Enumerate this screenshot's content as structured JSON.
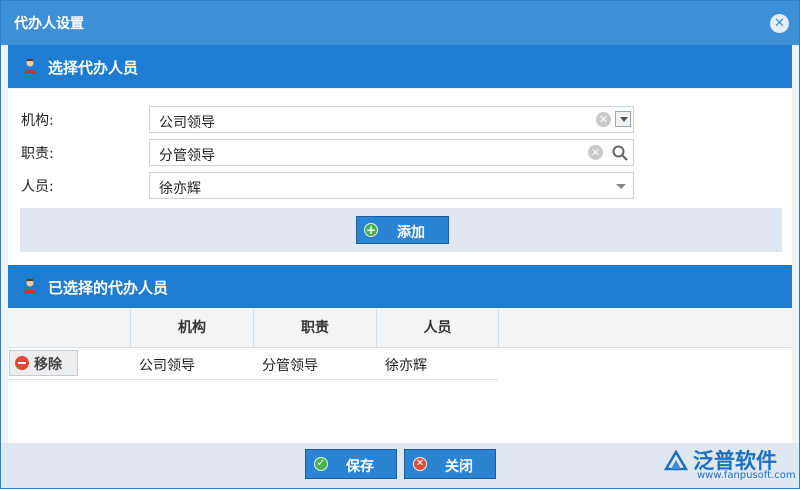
{
  "dialog": {
    "title": "代办人设置",
    "close_icon": "close-icon"
  },
  "section_select": {
    "title": "选择代办人员"
  },
  "form": {
    "org_label": "机构:",
    "org_value": "公司领导",
    "duty_label": "职责:",
    "duty_value": "分管领导",
    "person_label": "人员:",
    "person_value": "徐亦辉"
  },
  "add_button": {
    "label": "添加"
  },
  "section_selected": {
    "title": "已选择的代办人员"
  },
  "grid": {
    "headers": [
      "机构",
      "职责",
      "人员"
    ],
    "rows": [
      {
        "action": "移除",
        "org": "公司领导",
        "duty": "分管领导",
        "person": "徐亦辉"
      }
    ]
  },
  "footer": {
    "save_label": "保存",
    "close_label": "关闭",
    "logo_text": "泛普软件",
    "logo_url": "www.fanpusoft.com"
  },
  "colors": {
    "accent": "#1f7dd1",
    "titlebar": "#3d8fd6",
    "danger": "#e24a3a",
    "ok": "#4caf50"
  }
}
